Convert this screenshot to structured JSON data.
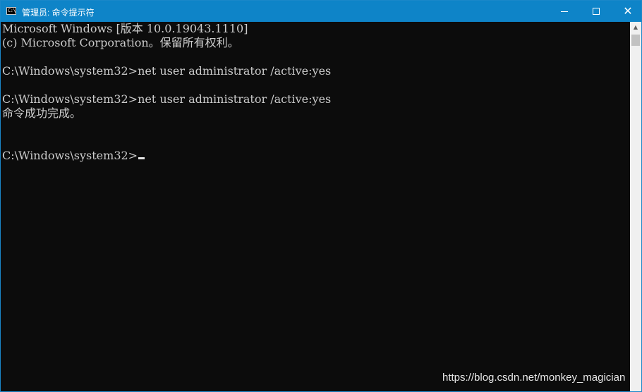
{
  "window": {
    "title": "管理员: 命令提示符",
    "icon": "cmd-icon",
    "icon_glyph": "C:\\",
    "minimize": "minimize-icon",
    "maximize": "maximize-icon",
    "close_glyph": "✕"
  },
  "console": {
    "lines": [
      "Microsoft Windows [版本 10.0.19043.1110]",
      "(c) Microsoft Corporation。保留所有权利。",
      "",
      "C:\\Windows\\system32>net user administrator /active:yes",
      "",
      "C:\\Windows\\system32>net user administrator /active:yes",
      "命令成功完成。",
      "",
      "",
      "C:\\Windows\\system32>"
    ]
  },
  "watermark": "https://blog.csdn.net/monkey_magician",
  "colors": {
    "titlebar": "#0e84c8",
    "console_bg": "#0c0c0c",
    "console_text": "#cccccc"
  }
}
